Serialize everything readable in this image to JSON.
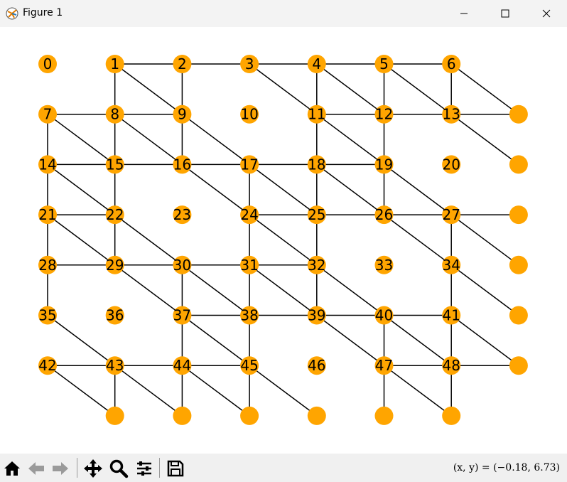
{
  "window": {
    "title": "Figure 1"
  },
  "toolbar": {
    "buttons": [
      "home-icon",
      "back-icon",
      "forward-icon",
      "pan-icon",
      "zoom-icon",
      "configure-icon",
      "save-icon"
    ],
    "coords": "(x, y) = (−0.18, 6.73)"
  },
  "graph": {
    "node_color": "#ffa500",
    "edge_color": "#000000",
    "labeled_nodes": [
      {
        "id": "0",
        "col": 0,
        "row": 0
      },
      {
        "id": "1",
        "col": 1,
        "row": 0
      },
      {
        "id": "2",
        "col": 2,
        "row": 0
      },
      {
        "id": "3",
        "col": 3,
        "row": 0
      },
      {
        "id": "4",
        "col": 4,
        "row": 0
      },
      {
        "id": "5",
        "col": 5,
        "row": 0
      },
      {
        "id": "6",
        "col": 6,
        "row": 0
      },
      {
        "id": "7",
        "col": 0,
        "row": 1
      },
      {
        "id": "8",
        "col": 1,
        "row": 1
      },
      {
        "id": "9",
        "col": 2,
        "row": 1
      },
      {
        "id": "10",
        "col": 3,
        "row": 1
      },
      {
        "id": "11",
        "col": 4,
        "row": 1
      },
      {
        "id": "12",
        "col": 5,
        "row": 1
      },
      {
        "id": "13",
        "col": 6,
        "row": 1
      },
      {
        "id": "14",
        "col": 0,
        "row": 2
      },
      {
        "id": "15",
        "col": 1,
        "row": 2
      },
      {
        "id": "16",
        "col": 2,
        "row": 2
      },
      {
        "id": "17",
        "col": 3,
        "row": 2
      },
      {
        "id": "18",
        "col": 4,
        "row": 2
      },
      {
        "id": "19",
        "col": 5,
        "row": 2
      },
      {
        "id": "20",
        "col": 6,
        "row": 2
      },
      {
        "id": "21",
        "col": 0,
        "row": 3
      },
      {
        "id": "22",
        "col": 1,
        "row": 3
      },
      {
        "id": "23",
        "col": 2,
        "row": 3
      },
      {
        "id": "24",
        "col": 3,
        "row": 3
      },
      {
        "id": "25",
        "col": 4,
        "row": 3
      },
      {
        "id": "26",
        "col": 5,
        "row": 3
      },
      {
        "id": "27",
        "col": 6,
        "row": 3
      },
      {
        "id": "28",
        "col": 0,
        "row": 4
      },
      {
        "id": "29",
        "col": 1,
        "row": 4
      },
      {
        "id": "30",
        "col": 2,
        "row": 4
      },
      {
        "id": "31",
        "col": 3,
        "row": 4
      },
      {
        "id": "32",
        "col": 4,
        "row": 4
      },
      {
        "id": "33",
        "col": 5,
        "row": 4
      },
      {
        "id": "34",
        "col": 6,
        "row": 4
      },
      {
        "id": "35",
        "col": 0,
        "row": 5
      },
      {
        "id": "36",
        "col": 1,
        "row": 5
      },
      {
        "id": "37",
        "col": 2,
        "row": 5
      },
      {
        "id": "38",
        "col": 3,
        "row": 5
      },
      {
        "id": "39",
        "col": 4,
        "row": 5
      },
      {
        "id": "40",
        "col": 5,
        "row": 5
      },
      {
        "id": "41",
        "col": 6,
        "row": 5
      },
      {
        "id": "42",
        "col": 0,
        "row": 6
      },
      {
        "id": "43",
        "col": 1,
        "row": 6
      },
      {
        "id": "44",
        "col": 2,
        "row": 6
      },
      {
        "id": "45",
        "col": 3,
        "row": 6
      },
      {
        "id": "46",
        "col": 4,
        "row": 6
      },
      {
        "id": "47",
        "col": 5,
        "row": 6
      },
      {
        "id": "48",
        "col": 6,
        "row": 6
      }
    ],
    "unlabeled_nodes": [
      {
        "col": 7,
        "row": 1
      },
      {
        "col": 7,
        "row": 2
      },
      {
        "col": 7,
        "row": 3
      },
      {
        "col": 7,
        "row": 4
      },
      {
        "col": 7,
        "row": 5
      },
      {
        "col": 7,
        "row": 6
      },
      {
        "col": 1,
        "row": 7
      },
      {
        "col": 2,
        "row": 7
      },
      {
        "col": 3,
        "row": 7
      },
      {
        "col": 4,
        "row": 7
      },
      {
        "col": 5,
        "row": 7
      },
      {
        "col": 6,
        "row": 7
      }
    ],
    "edges": [
      [
        1,
        0,
        2,
        0
      ],
      [
        2,
        0,
        3,
        0
      ],
      [
        3,
        0,
        4,
        0
      ],
      [
        4,
        0,
        5,
        0
      ],
      [
        5,
        0,
        6,
        0
      ],
      [
        1,
        0,
        1,
        1
      ],
      [
        1,
        0,
        2,
        1
      ],
      [
        2,
        0,
        2,
        1
      ],
      [
        3,
        0,
        4,
        1
      ],
      [
        4,
        0,
        4,
        1
      ],
      [
        4,
        0,
        5,
        1
      ],
      [
        5,
        0,
        5,
        1
      ],
      [
        5,
        0,
        6,
        1
      ],
      [
        6,
        0,
        6,
        1
      ],
      [
        6,
        0,
        7,
        1
      ],
      [
        0,
        1,
        1,
        1
      ],
      [
        1,
        1,
        2,
        1
      ],
      [
        4,
        1,
        5,
        1
      ],
      [
        5,
        1,
        6,
        1
      ],
      [
        6,
        1,
        7,
        1
      ],
      [
        0,
        1,
        0,
        2
      ],
      [
        0,
        1,
        1,
        2
      ],
      [
        1,
        1,
        1,
        2
      ],
      [
        1,
        1,
        2,
        2
      ],
      [
        2,
        1,
        2,
        2
      ],
      [
        2,
        1,
        3,
        2
      ],
      [
        4,
        1,
        4,
        2
      ],
      [
        4,
        1,
        5,
        2
      ],
      [
        5,
        1,
        5,
        2
      ],
      [
        6,
        1,
        7,
        2
      ],
      [
        0,
        2,
        1,
        2
      ],
      [
        1,
        2,
        2,
        2
      ],
      [
        2,
        2,
        3,
        2
      ],
      [
        3,
        2,
        4,
        2
      ],
      [
        4,
        2,
        5,
        2
      ],
      [
        0,
        2,
        0,
        3
      ],
      [
        0,
        2,
        1,
        3
      ],
      [
        1,
        2,
        1,
        3
      ],
      [
        2,
        2,
        3,
        3
      ],
      [
        3,
        2,
        3,
        3
      ],
      [
        3,
        2,
        4,
        3
      ],
      [
        4,
        2,
        4,
        3
      ],
      [
        4,
        2,
        5,
        3
      ],
      [
        5,
        2,
        5,
        3
      ],
      [
        5,
        2,
        6,
        3
      ],
      [
        0,
        3,
        1,
        3
      ],
      [
        3,
        3,
        4,
        3
      ],
      [
        4,
        3,
        5,
        3
      ],
      [
        5,
        3,
        6,
        3
      ],
      [
        6,
        3,
        7,
        3
      ],
      [
        0,
        3,
        0,
        4
      ],
      [
        0,
        3,
        1,
        4
      ],
      [
        1,
        3,
        1,
        4
      ],
      [
        1,
        3,
        2,
        4
      ],
      [
        3,
        3,
        3,
        4
      ],
      [
        3,
        3,
        4,
        4
      ],
      [
        4,
        3,
        4,
        4
      ],
      [
        5,
        3,
        6,
        4
      ],
      [
        6,
        3,
        6,
        4
      ],
      [
        6,
        3,
        7,
        4
      ],
      [
        0,
        4,
        1,
        4
      ],
      [
        1,
        4,
        2,
        4
      ],
      [
        2,
        4,
        3,
        4
      ],
      [
        3,
        4,
        4,
        4
      ],
      [
        0,
        4,
        0,
        5
      ],
      [
        1,
        4,
        2,
        5
      ],
      [
        2,
        4,
        2,
        5
      ],
      [
        2,
        4,
        3,
        5
      ],
      [
        3,
        4,
        3,
        5
      ],
      [
        3,
        4,
        4,
        5
      ],
      [
        4,
        4,
        4,
        5
      ],
      [
        4,
        4,
        5,
        5
      ],
      [
        6,
        4,
        6,
        5
      ],
      [
        6,
        4,
        7,
        5
      ],
      [
        2,
        5,
        3,
        5
      ],
      [
        3,
        5,
        4,
        5
      ],
      [
        4,
        5,
        5,
        5
      ],
      [
        5,
        5,
        6,
        5
      ],
      [
        0,
        5,
        1,
        6
      ],
      [
        2,
        5,
        2,
        6
      ],
      [
        2,
        5,
        3,
        6
      ],
      [
        3,
        5,
        3,
        6
      ],
      [
        4,
        5,
        5,
        6
      ],
      [
        5,
        5,
        5,
        6
      ],
      [
        5,
        5,
        6,
        6
      ],
      [
        6,
        5,
        6,
        6
      ],
      [
        6,
        5,
        7,
        6
      ],
      [
        0,
        6,
        1,
        6
      ],
      [
        1,
        6,
        2,
        6
      ],
      [
        2,
        6,
        3,
        6
      ],
      [
        5,
        6,
        6,
        6
      ],
      [
        6,
        6,
        7,
        6
      ],
      [
        0,
        6,
        1,
        7
      ],
      [
        1,
        6,
        1,
        7
      ],
      [
        1,
        6,
        2,
        7
      ],
      [
        2,
        6,
        2,
        7
      ],
      [
        2,
        6,
        3,
        7
      ],
      [
        3,
        6,
        3,
        7
      ],
      [
        3,
        6,
        4,
        7
      ],
      [
        5,
        6,
        5,
        7
      ],
      [
        5,
        6,
        6,
        7
      ],
      [
        6,
        6,
        6,
        7
      ]
    ]
  }
}
